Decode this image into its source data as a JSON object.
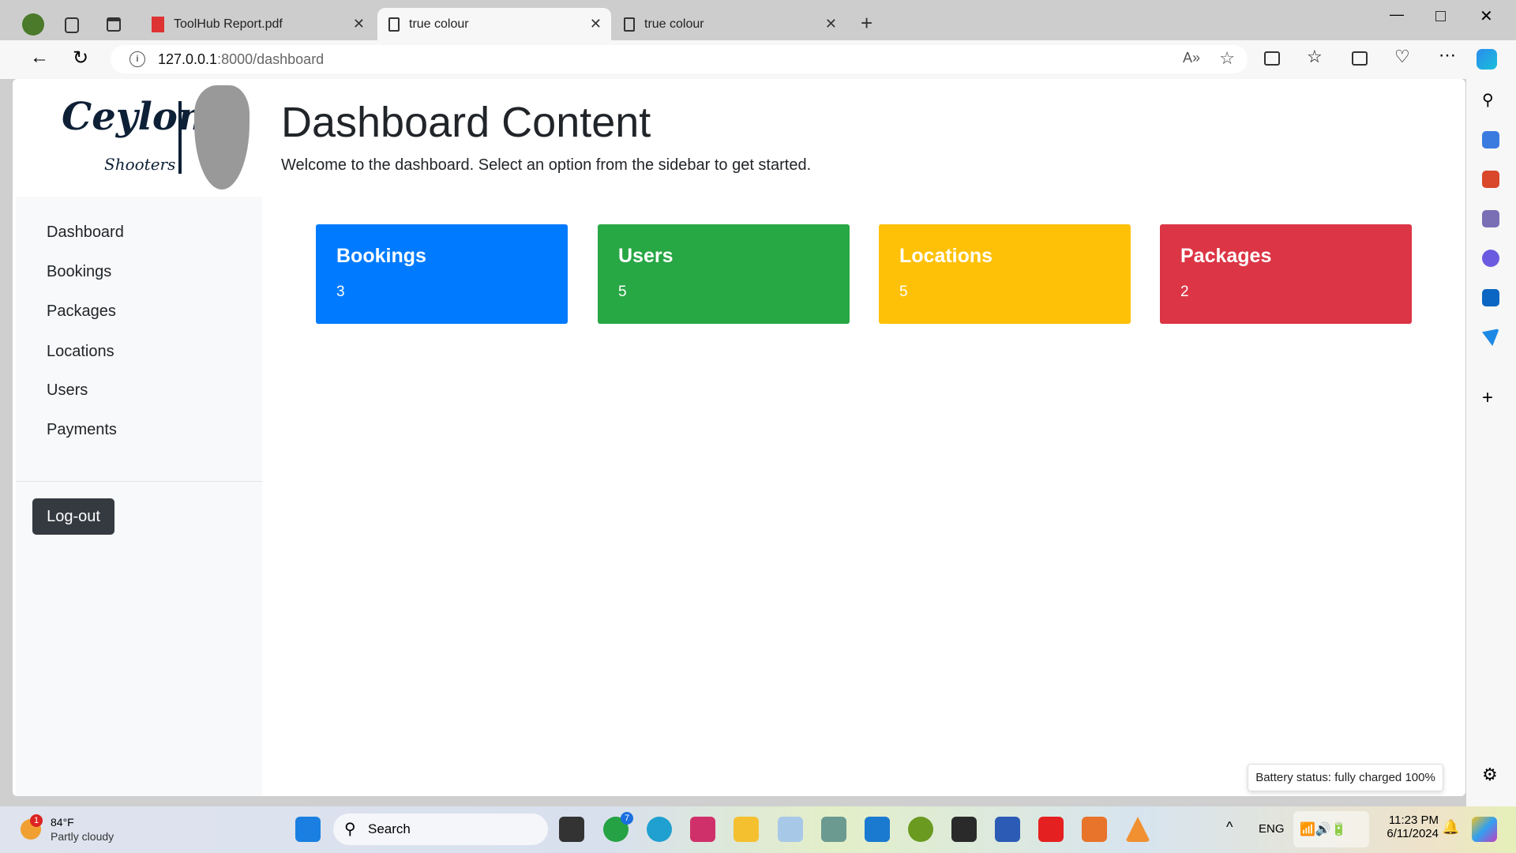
{
  "browser": {
    "tabs": [
      {
        "label": "ToolHub Report.pdf",
        "icon": "pdf-icon"
      },
      {
        "label": "true colour",
        "icon": "page-icon",
        "active": true
      },
      {
        "label": "true colour",
        "icon": "page-icon"
      }
    ],
    "url_host": "127.0.0.1",
    "url_rest": ":8000/dashboard"
  },
  "logo": {
    "text": "Ceylon",
    "sub": "Shooters"
  },
  "sidebar": {
    "items": [
      {
        "label": "Dashboard"
      },
      {
        "label": "Bookings"
      },
      {
        "label": "Packages"
      },
      {
        "label": "Locations"
      },
      {
        "label": "Users"
      },
      {
        "label": "Payments"
      }
    ],
    "logout": "Log-out"
  },
  "main": {
    "title": "Dashboard Content",
    "subtitle": "Welcome to the dashboard. Select an option from the sidebar to get started.",
    "cards": [
      {
        "title": "Bookings",
        "value": "3",
        "color": "#007bff"
      },
      {
        "title": "Users",
        "value": "5",
        "color": "#28a745"
      },
      {
        "title": "Locations",
        "value": "5",
        "color": "#ffc107"
      },
      {
        "title": "Packages",
        "value": "2",
        "color": "#dc3545"
      }
    ]
  },
  "tooltip": "Battery status: fully charged 100%",
  "taskbar": {
    "weather_temp": "84°F",
    "weather_desc": "Partly cloudy",
    "search": "Search",
    "lang": "ENG",
    "time": "11:23 PM",
    "date": "6/11/2024",
    "whatsapp_badge": "7",
    "weather_badge": "1"
  }
}
